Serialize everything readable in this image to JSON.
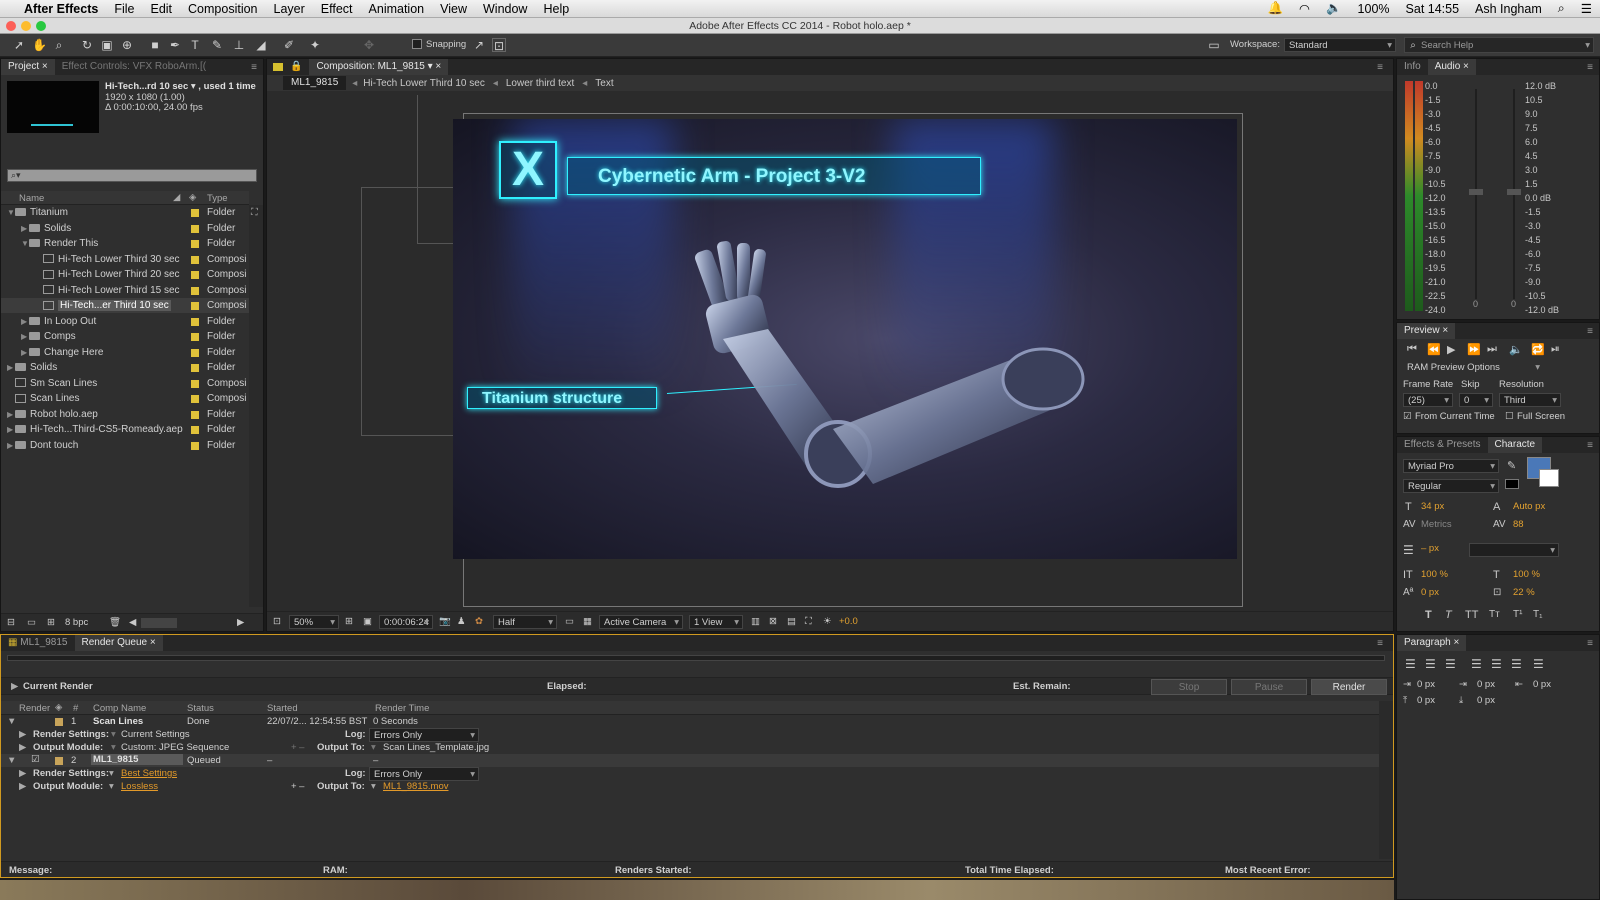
{
  "menubar": {
    "items": [
      "After Effects",
      "File",
      "Edit",
      "Composition",
      "Layer",
      "Effect",
      "Animation",
      "View",
      "Window",
      "Help"
    ],
    "status": {
      "battery": "100%",
      "clock": "Sat 14:55",
      "user": "Ash Ingham"
    }
  },
  "window_title": "Adobe After Effects CC 2014 - Robot holo.aep *",
  "toolbar": {
    "snapping_label": "Snapping",
    "workspace_label": "Workspace:",
    "workspace_value": "Standard",
    "search_placeholder": "Search Help"
  },
  "project_panel": {
    "tabs": [
      "Project",
      "Effect Controls: VFX RoboArm.[("
    ],
    "selected_item": {
      "name": "Hi-Tech...rd 10 sec ▾ , used 1 time",
      "resolution": "1920 x 1080 (1.00)",
      "duration": "Δ 0:00:10:00, 24.00 fps"
    },
    "columns": {
      "name": "Name",
      "type": "Type"
    },
    "items": [
      {
        "label": "Titanium",
        "type": "Folder",
        "kind": "folder",
        "open": true,
        "indent": 0
      },
      {
        "label": "Solids",
        "type": "Folder",
        "kind": "folder",
        "open": false,
        "indent": 1
      },
      {
        "label": "Render This",
        "type": "Folder",
        "kind": "folder",
        "open": true,
        "indent": 1
      },
      {
        "label": "Hi-Tech Lower Third 30 sec",
        "type": "Composi",
        "kind": "comp",
        "indent": 2
      },
      {
        "label": "Hi-Tech Lower Third 20 sec",
        "type": "Composi",
        "kind": "comp",
        "indent": 2
      },
      {
        "label": "Hi-Tech Lower Third 15 sec",
        "type": "Composi",
        "kind": "comp",
        "indent": 2
      },
      {
        "label": "Hi-Tech...er Third 10 sec",
        "type": "Composi",
        "kind": "comp",
        "indent": 2,
        "selected": true
      },
      {
        "label": "In Loop Out",
        "type": "Folder",
        "kind": "folder",
        "open": false,
        "indent": 1
      },
      {
        "label": "Comps",
        "type": "Folder",
        "kind": "folder",
        "open": false,
        "indent": 1
      },
      {
        "label": "Change Here",
        "type": "Folder",
        "kind": "folder",
        "open": false,
        "indent": 1
      },
      {
        "label": "Solids",
        "type": "Folder",
        "kind": "folder",
        "open": false,
        "indent": 0
      },
      {
        "label": "Sm Scan Lines",
        "type": "Composi",
        "kind": "comp",
        "indent": 0
      },
      {
        "label": "Scan Lines",
        "type": "Composi",
        "kind": "comp",
        "indent": 0
      },
      {
        "label": "Robot holo.aep",
        "type": "Folder",
        "kind": "folder",
        "open": false,
        "indent": 0
      },
      {
        "label": "Hi-Tech...Third-CS5-Romeady.aep",
        "type": "Folder",
        "kind": "folder",
        "open": false,
        "indent": 0
      },
      {
        "label": "Dont touch",
        "type": "Folder",
        "kind": "folder",
        "open": false,
        "indent": 0
      }
    ],
    "bpc": "8 bpc"
  },
  "composition": {
    "tab_label": "Composition: ML1_9815",
    "breadcrumbs": [
      "ML1_9815",
      "Hi-Tech Lower Third 10 sec",
      "Lower third text",
      "Text"
    ],
    "title_text": "Cybernetic Arm - Project 3-V2",
    "logo_letter": "X",
    "callout_text": "Titanium structure",
    "footer": {
      "zoom": "50%",
      "timecode": "0:00:06:24",
      "resolution": "Half",
      "camera": "Active Camera",
      "view": "1 View",
      "exposure": "+0.0"
    }
  },
  "audio_panel": {
    "tabs": [
      "Info",
      "Audio"
    ],
    "left_scale": [
      "0.0",
      "-1.5",
      "-3.0",
      "-4.5",
      "-6.0",
      "-7.5",
      "-9.0",
      "-10.5",
      "-12.0",
      "-13.5",
      "-15.0",
      "-16.5",
      "-18.0",
      "-19.5",
      "-21.0",
      "-22.5",
      "-24.0"
    ],
    "right_scale": [
      "12.0 dB",
      "10.5",
      "9.0",
      "7.5",
      "6.0",
      "4.5",
      "3.0",
      "1.5",
      "0.0 dB",
      "-1.5",
      "-3.0",
      "-4.5",
      "-6.0",
      "-7.5",
      "-9.0",
      "-10.5",
      "-12.0 dB"
    ],
    "zero_a": "0",
    "zero_b": "0"
  },
  "preview_panel": {
    "tab": "Preview",
    "ram_options": "RAM Preview Options",
    "frame_rate_label": "Frame Rate",
    "skip_label": "Skip",
    "resolution_label": "Resolution",
    "frame_rate": "(25)",
    "skip": "0",
    "resolution": "Third",
    "from_current": "From Current Time",
    "full_screen": "Full Screen"
  },
  "character_panel": {
    "tabs": [
      "Effects & Presets",
      "Characte"
    ],
    "font": "Myriad Pro",
    "style": "Regular",
    "size": "34 px",
    "leading": "Auto px",
    "kerning": "Metrics",
    "tracking": "88",
    "stroke": "– px",
    "vscale": "100 %",
    "hscale": "100 %",
    "baseline": "0 px",
    "tsume": "22 %",
    "fill_color": "#4a78b8",
    "stroke_color": "#000000"
  },
  "paragraph_panel": {
    "tab": "Paragraph",
    "indent_left": "0 px",
    "indent_first": "0 px",
    "indent_right": "0 px",
    "space_before": "0 px",
    "space_after": "0 px"
  },
  "render_queue": {
    "tabs": [
      "ML1_9815",
      "Render Queue"
    ],
    "current_render": "Current Render",
    "elapsed": "Elapsed:",
    "est_remain": "Est. Remain:",
    "stop": "Stop",
    "pause": "Pause",
    "render": "Render",
    "columns": [
      "Render",
      "#",
      "Comp Name",
      "Status",
      "Started",
      "Render Time"
    ],
    "items": [
      {
        "num": "1",
        "name": "Scan Lines",
        "status": "Done",
        "started": "22/07/2... 12:54:55 BST",
        "time": "0 Seconds",
        "render_settings": "Current Settings",
        "output_module": "Custom: JPEG Sequence",
        "log": "Errors Only",
        "output_to": "Scan Lines_Template.jpg"
      },
      {
        "num": "2",
        "name": "ML1_9815",
        "status": "Queued",
        "started": "–",
        "time": "–",
        "render_settings": "Best Settings",
        "output_module": "Lossless",
        "log": "Errors Only",
        "output_to": "ML1_9815.mov"
      }
    ],
    "labels": {
      "render_settings": "Render Settings:",
      "output_module": "Output Module:",
      "log": "Log:",
      "output_to": "Output To:"
    },
    "footer": {
      "message": "Message:",
      "ram": "RAM:",
      "renders_started": "Renders Started:",
      "total_time": "Total Time Elapsed:",
      "recent_error": "Most Recent Error:"
    }
  }
}
